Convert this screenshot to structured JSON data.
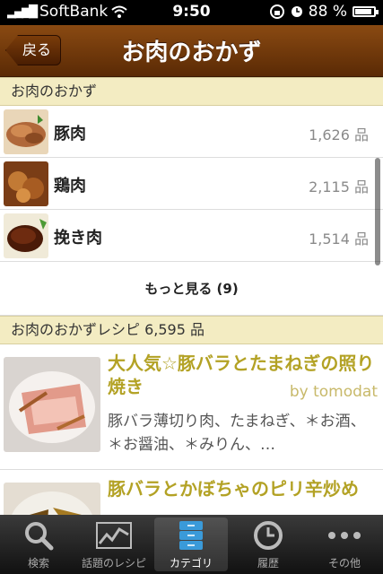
{
  "status_bar": {
    "carrier": "SoftBank",
    "time": "9:50",
    "battery": "88 %",
    "battery_level": 0.88
  },
  "nav": {
    "back_label": "戻る",
    "title": "お肉のおかず"
  },
  "category_section": {
    "header": "お肉のおかず"
  },
  "categories": [
    {
      "name": "豚肉",
      "count": "1,626 品"
    },
    {
      "name": "鶏肉",
      "count": "2,115 品"
    },
    {
      "name": "挽き肉",
      "count": "1,514 品"
    }
  ],
  "more_label": "もっと見る (9)",
  "recipe_section": {
    "header": "お肉のおかずレシピ 6,595 品"
  },
  "recipes": [
    {
      "title": "大人気☆豚バラとたまねぎの照り焼き",
      "author": "by tomodat",
      "ingredients": "豚バラ薄切り肉、たまねぎ、＊お酒、＊お醤油、＊みりん、…"
    },
    {
      "title": "豚バラとかぼちゃのピリ辛炒め",
      "author": "",
      "ingredients": ""
    }
  ],
  "tabs": [
    {
      "label": "検索",
      "icon": "search-icon"
    },
    {
      "label": "話題のレシピ",
      "icon": "trend-chart-icon"
    },
    {
      "label": "カテゴリ",
      "icon": "category-drawer-icon",
      "active": true
    },
    {
      "label": "履歴",
      "icon": "clock-icon"
    },
    {
      "label": "その他",
      "icon": "more-dots-icon"
    }
  ],
  "colors": {
    "nav_brown": "#6f3a0c",
    "section_bg": "#f3ecc2",
    "recipe_title": "#b3a225"
  }
}
